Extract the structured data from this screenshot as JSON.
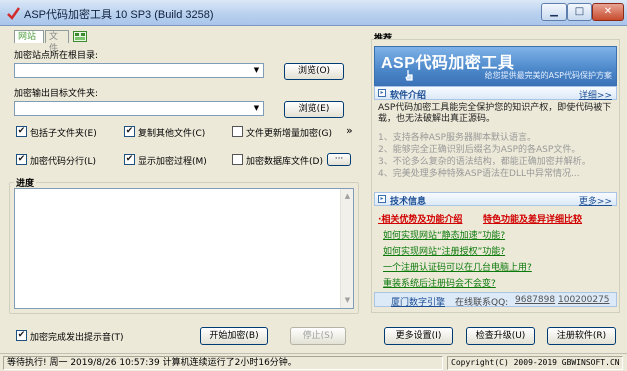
{
  "window": {
    "title": "ASP代码加密工具 10 SP3 (Build 3258)"
  },
  "tabs": [
    {
      "label": "网站"
    },
    {
      "label": "文件"
    }
  ],
  "form": {
    "site_root_label": "加密站点所在根目录:",
    "site_root_value": "",
    "browse1_label": "浏览(O)",
    "output_label": "加密输出目标文件夹:",
    "output_value": "",
    "browse2_label": "浏览(E)",
    "more_label": "»",
    "ellipsis_label": "···"
  },
  "options": [
    {
      "label": "包括子文件夹(E)",
      "checked": true
    },
    {
      "label": "复制其他文件(C)",
      "checked": true
    },
    {
      "label": "文件更新增量加密(G)",
      "checked": false
    },
    {
      "label": "加密代码分行(L)",
      "checked": true
    },
    {
      "label": "显示加密过程(M)",
      "checked": true
    },
    {
      "label": "加密数据库文件(D)",
      "checked": false
    }
  ],
  "progress": {
    "title": "进度"
  },
  "bottom": {
    "notify": {
      "label": "加密完成发出提示音(T)",
      "checked": true
    },
    "start_label": "开始加密(B)",
    "stop_label": "停止(S)"
  },
  "recommend": {
    "title": "推荐",
    "banner_title": "ASP代码加密工具",
    "banner_sub": "给您提供最完美的ASP代码保护方案",
    "intro_head": "软件介绍",
    "intro_more": "详细>>",
    "intro_text": "ASP代码加密工具能完全保护您的知识产权，即使代码被下载，也无法破解出真正源码。",
    "features": [
      "1、支持各种ASP服务器脚本默认语言。",
      "2、能够完全正确识别后缀名为ASP的各ASP文件。",
      "3、不论多么复杂的语法结构，都能正确加密并解析。",
      "4、完美处理多种特殊ASP语法在DLL中异常情况..."
    ],
    "tech_head": "技术信息",
    "tech_more": "更多>>",
    "tech_links": [
      {
        "text": "·相关优势及功能介绍",
        "style": "red"
      },
      {
        "text": "特色功能及差异详细比较",
        "style": "red2"
      },
      {
        "text": "如何实现网站“静态加速”功能?",
        "style": "green"
      },
      {
        "text": "如何实现网站“注册授权”功能?",
        "style": "green"
      },
      {
        "text": "一个注册认证码可以在几台电脑上用?",
        "style": "green"
      },
      {
        "text": "重装系统后注册码会不会变?",
        "style": "green"
      }
    ],
    "qq_link": "厦门数字引擎",
    "qq_label": "在线联系QQ:",
    "qq1": "9687898",
    "qq2": "100200275"
  },
  "right_buttons": {
    "more_settings": "更多设置(I)",
    "check_update": "检查升级(U)",
    "register": "注册软件(R)"
  },
  "status": {
    "left": "等待执行! 周一 2019/8/26 10:57:39 计算机连续运行了2小时16分钟。",
    "right": "Copyright(C) 2009-2019 GBWINSOFT.CN"
  },
  "colors": {
    "accent": "#3b73b8",
    "link_red": "#d10000",
    "link_green": "#0b7a0b"
  }
}
